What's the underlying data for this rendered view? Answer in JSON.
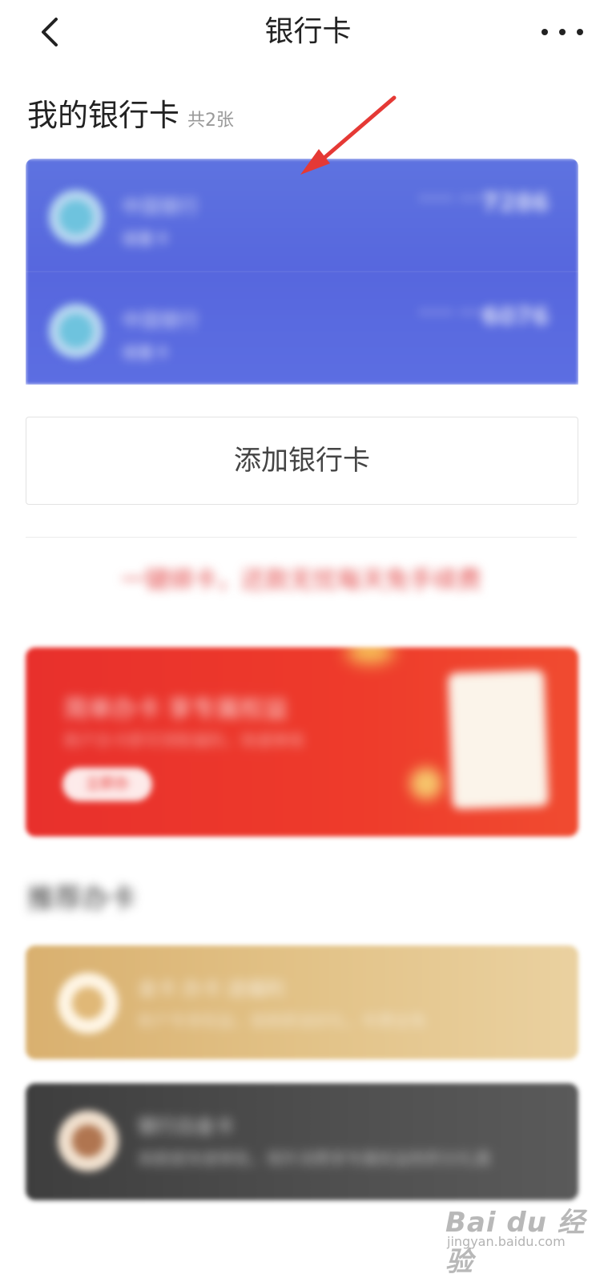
{
  "header": {
    "title": "银行卡",
    "back_icon": "chevron-left-icon",
    "more_icon": "more-horizontal-icon"
  },
  "my_cards": {
    "title": "我的银行卡",
    "count": "共2张",
    "cards": [
      {
        "bank_name": "中国银行",
        "card_type": "储蓄卡",
        "mask": "**** ****",
        "last4": "7286"
      },
      {
        "bank_name": "中国银行",
        "card_type": "储蓄卡",
        "mask": "**** ****",
        "last4": "6076"
      }
    ]
  },
  "add_card": {
    "label": "添加银行卡"
  },
  "promo": {
    "text": "一键绑卡，还款无忧每天免手续费"
  },
  "banner": {
    "title": "简单办卡 享专属权益",
    "subtitle": "新户办卡即可领取福利，快速审核",
    "button": "立即办"
  },
  "recommended": {
    "title": "推荐办卡",
    "cards": [
      {
        "name": "金卡 办卡 送福利",
        "desc": "新户专享权益，首刷即送好礼，年费全免"
      },
      {
        "name": "银行白金卡",
        "desc": "高额度快速审批，境外消费享专属权益和积分礼遇"
      }
    ]
  },
  "watermark": {
    "logo": "Bai du 经验",
    "sub": "jingyan.baidu.com"
  },
  "colors": {
    "card_blue": "#5a6ddf",
    "banner_red": "#ea332c",
    "gold": "#e0bd80",
    "dark": "#4a4a4a",
    "arrow": "#e53935"
  }
}
